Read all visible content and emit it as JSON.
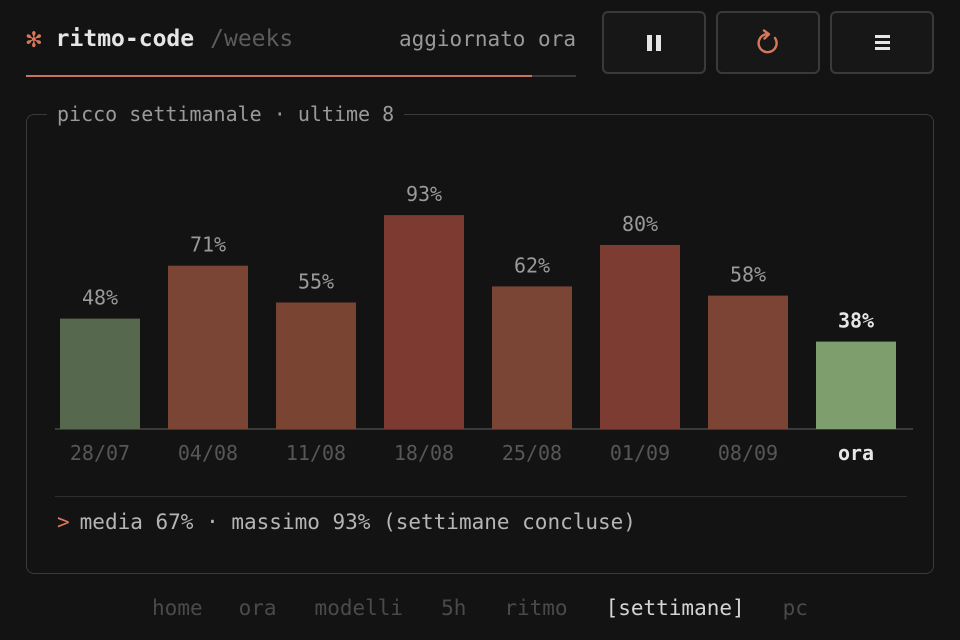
{
  "header": {
    "icon": "asterisk-icon",
    "accent": "#d9775a",
    "app_name": "ritmo-code",
    "view": "/weeks",
    "status": "aggiornato ora",
    "progress": 0.92
  },
  "toolbar": {
    "pause_icon": "pause-icon",
    "refresh_icon": "refresh-icon",
    "menu_icon": "menu-icon"
  },
  "panel": {
    "title": "picco settimanale · ultime 8",
    "summary_prompt": ">",
    "summary": "media 67% · massimo 93% (settimane concluse)"
  },
  "chart_data": {
    "type": "bar",
    "title": "picco settimanale · ultime 8",
    "categories": [
      "28/07",
      "04/08",
      "11/08",
      "18/08",
      "25/08",
      "01/09",
      "08/09",
      "ora"
    ],
    "values": [
      48,
      71,
      55,
      93,
      62,
      80,
      58,
      38
    ],
    "data_labels": [
      "48%",
      "71%",
      "55%",
      "93%",
      "62%",
      "80%",
      "58%",
      "38%"
    ],
    "unit": "%",
    "ylim": [
      0,
      100
    ],
    "grid": false,
    "legend": "none",
    "highlight_category": "ora",
    "colors": [
      "#56684d",
      "#7b4535",
      "#7a4433",
      "#7d3a30",
      "#7b4535",
      "#7c3c32",
      "#7c4434",
      "#7f9e6d"
    ]
  },
  "nav": {
    "items": [
      {
        "label": "home",
        "active": false
      },
      {
        "label": "ora",
        "active": false
      },
      {
        "label": "modelli",
        "active": false
      },
      {
        "label": "5h",
        "active": false
      },
      {
        "label": "ritmo",
        "active": false
      },
      {
        "label": "[settimane]",
        "active": true
      },
      {
        "label": "pc",
        "active": false
      }
    ]
  }
}
